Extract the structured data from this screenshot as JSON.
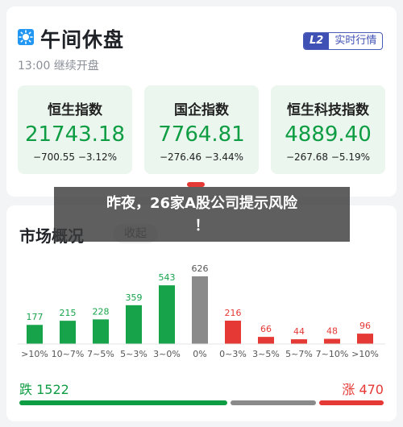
{
  "header": {
    "title": "午间休盘",
    "status": "13:00 继续开盘",
    "realtime_tag": "L2",
    "realtime_label": "实时行情"
  },
  "indices": [
    {
      "name": "恒生指数",
      "value": "21743.18",
      "change": "−700.55  −3.12%"
    },
    {
      "name": "国企指数",
      "value": "7764.81",
      "change": "−276.46  −3.44%"
    },
    {
      "name": "恒生科技指数",
      "value": "4889.40",
      "change": "−267.68  −5.19%"
    }
  ],
  "market": {
    "title": "市场概况",
    "collapse_label": "收起",
    "fall_text": "跌 1522",
    "rise_text": "涨 470"
  },
  "overlay": {
    "line1": "昨夜，26家A股公司提示风险",
    "line2": "！"
  },
  "chart_data": {
    "type": "bar",
    "categories": [
      ">10%",
      "10~7%",
      "7~5%",
      "5~3%",
      "3~0%",
      "0%",
      "0~3%",
      "3~5%",
      "5~7%",
      "7~10%",
      ">10%"
    ],
    "values": [
      177,
      215,
      228,
      359,
      543,
      626,
      216,
      66,
      44,
      48,
      96
    ],
    "bar_colors": [
      "#17a34a",
      "#17a34a",
      "#17a34a",
      "#17a34a",
      "#17a34a",
      "#8a8a8a",
      "#e53935",
      "#e53935",
      "#e53935",
      "#e53935",
      "#e53935"
    ],
    "ylim": [
      0,
      626
    ]
  },
  "colors": {
    "down": "#0f9d43",
    "up": "#e53935",
    "flat": "#8a8a8a",
    "accent": "#3f51b5"
  }
}
